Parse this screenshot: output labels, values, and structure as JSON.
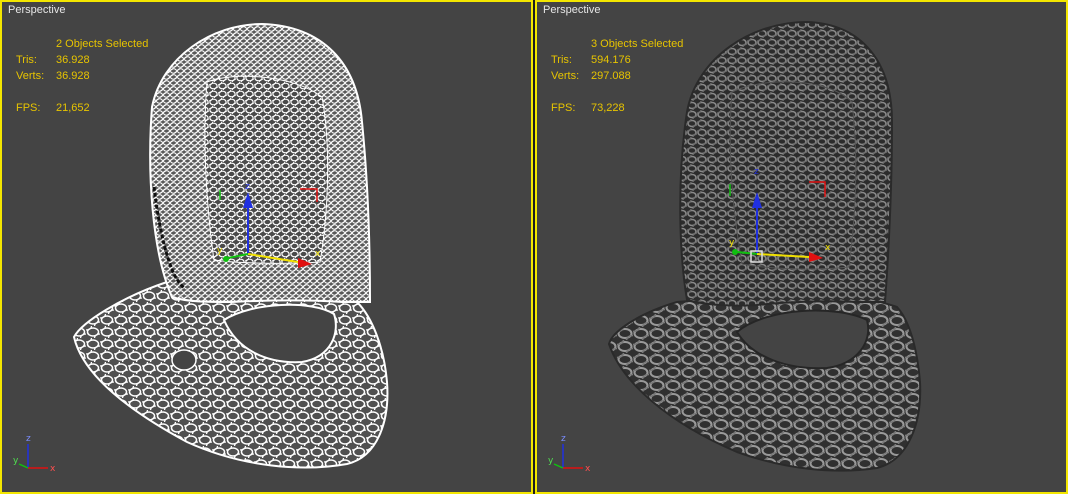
{
  "viewports": [
    {
      "id": "left",
      "label": "Perspective",
      "mode": "wireframe",
      "selection": "2 Objects Selected",
      "tris_label": "Tris:",
      "tris": "36.928",
      "verts_label": "Verts:",
      "verts": "36.928",
      "fps_label": "FPS:",
      "fps": "21,652"
    },
    {
      "id": "right",
      "label": "Perspective",
      "mode": "shaded",
      "selection": "3 Objects Selected",
      "tris_label": "Tris:",
      "tris": "594.176",
      "verts_label": "Verts:",
      "verts": "297.088",
      "fps_label": "FPS:",
      "fps": "73,228"
    }
  ],
  "gizmo": {
    "x": "x",
    "y": "y",
    "z": "z"
  },
  "tripod": {
    "x": "x",
    "y": "y",
    "z": "z"
  },
  "colors": {
    "active_border": "#f3e600",
    "viewport_bg": "#444444",
    "stats_text": "#e7c400",
    "label_text": "#e6e6e6",
    "wire": "#ffffff",
    "mesh_shaded": "#7a7a7a",
    "axis_x": "#e01010",
    "axis_y": "#10c010",
    "axis_z": "#2030e0",
    "gizmo_yellow": "#f0e000"
  }
}
